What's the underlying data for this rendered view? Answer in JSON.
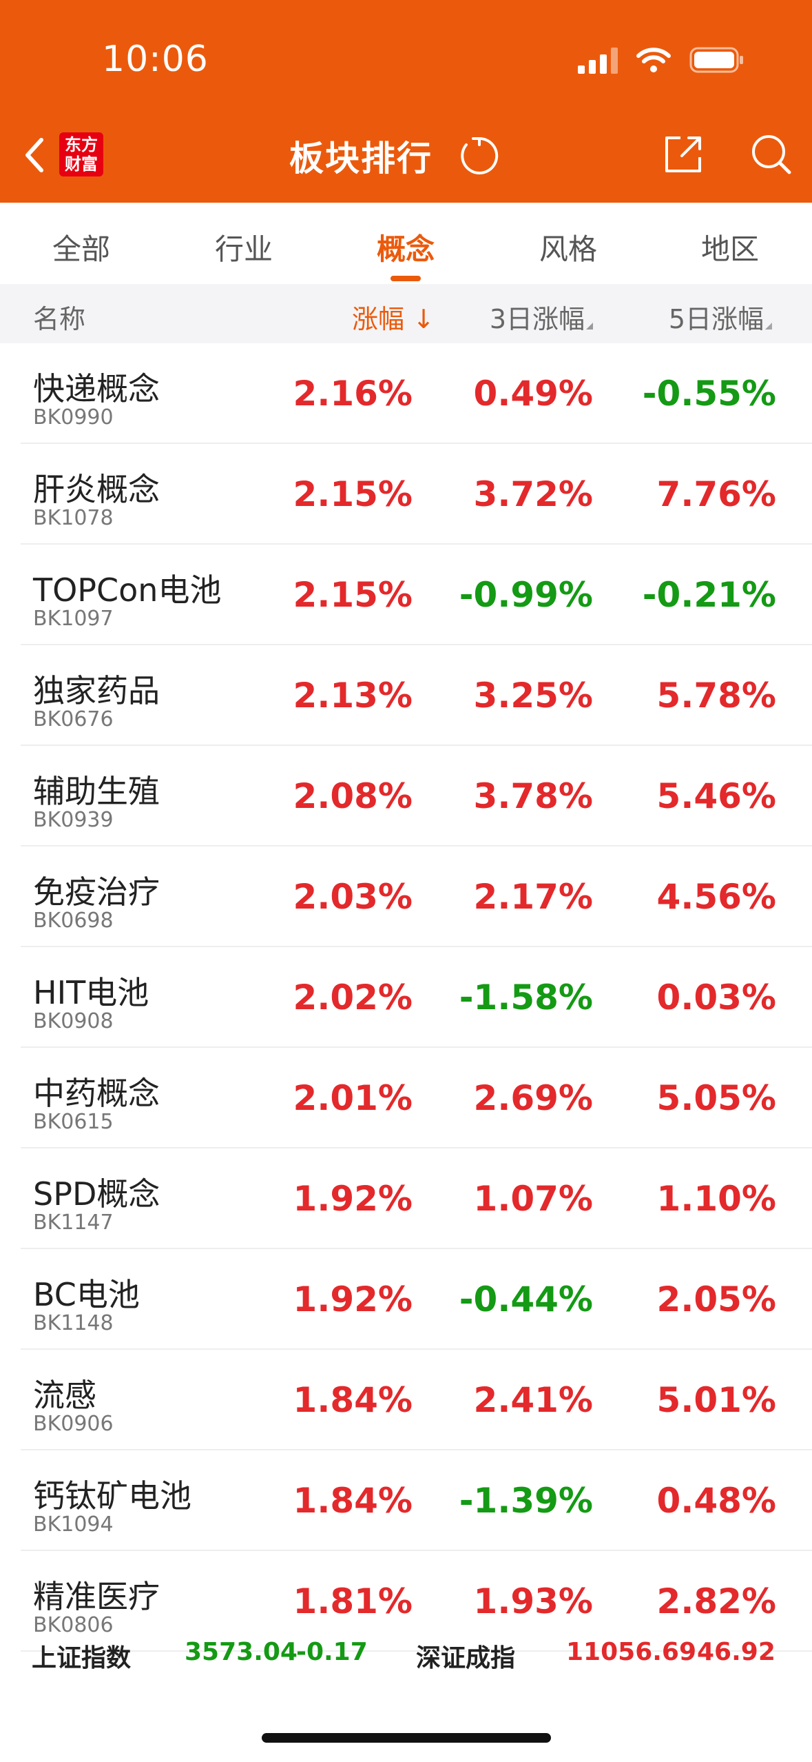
{
  "status": {
    "time": "10:06"
  },
  "header": {
    "title": "板块排行",
    "logo_line1": "东方",
    "logo_line2": "财富"
  },
  "tabs": [
    {
      "label": "全部",
      "active": false
    },
    {
      "label": "行业",
      "active": false
    },
    {
      "label": "概念",
      "active": true
    },
    {
      "label": "风格",
      "active": false
    },
    {
      "label": "地区",
      "active": false
    }
  ],
  "columns": {
    "name": "名称",
    "change": "涨幅",
    "change_sort_arrow": "↓",
    "change3d": "3日涨幅",
    "change5d": "5日涨幅"
  },
  "rows": [
    {
      "name": "快递概念",
      "code": "BK0990",
      "chg": "2.16%",
      "chg3": "0.49%",
      "chg5": "-0.55%"
    },
    {
      "name": "肝炎概念",
      "code": "BK1078",
      "chg": "2.15%",
      "chg3": "3.72%",
      "chg5": "7.76%"
    },
    {
      "name": "TOPCon电池",
      "code": "BK1097",
      "chg": "2.15%",
      "chg3": "-0.99%",
      "chg5": "-0.21%"
    },
    {
      "name": "独家药品",
      "code": "BK0676",
      "chg": "2.13%",
      "chg3": "3.25%",
      "chg5": "5.78%"
    },
    {
      "name": "辅助生殖",
      "code": "BK0939",
      "chg": "2.08%",
      "chg3": "3.78%",
      "chg5": "5.46%"
    },
    {
      "name": "免疫治疗",
      "code": "BK0698",
      "chg": "2.03%",
      "chg3": "2.17%",
      "chg5": "4.56%"
    },
    {
      "name": "HIT电池",
      "code": "BK0908",
      "chg": "2.02%",
      "chg3": "-1.58%",
      "chg5": "0.03%"
    },
    {
      "name": "中药概念",
      "code": "BK0615",
      "chg": "2.01%",
      "chg3": "2.69%",
      "chg5": "5.05%"
    },
    {
      "name": "SPD概念",
      "code": "BK1147",
      "chg": "1.92%",
      "chg3": "1.07%",
      "chg5": "1.10%"
    },
    {
      "name": "BC电池",
      "code": "BK1148",
      "chg": "1.92%",
      "chg3": "-0.44%",
      "chg5": "2.05%"
    },
    {
      "name": "流感",
      "code": "BK0906",
      "chg": "1.84%",
      "chg3": "2.41%",
      "chg5": "5.01%"
    },
    {
      "name": "钙钛矿电池",
      "code": "BK1094",
      "chg": "1.84%",
      "chg3": "-1.39%",
      "chg5": "0.48%"
    },
    {
      "name": "精准医疗",
      "code": "BK0806",
      "chg": "1.81%",
      "chg3": "1.93%",
      "chg5": "2.82%"
    }
  ],
  "index_bar": {
    "sh_label": "上证指数",
    "sh_value": "3573.04",
    "sh_change": "-0.17",
    "sz_label": "深证成指",
    "sz_value": "11056.69",
    "sz_change": "46.92"
  },
  "colors": {
    "brand": "#eb5a0c",
    "up": "#e3292b",
    "down": "#149a14"
  },
  "icons": [
    "back-icon",
    "refresh-icon",
    "share-icon",
    "search-icon",
    "signal-icon",
    "wifi-icon",
    "battery-icon"
  ]
}
